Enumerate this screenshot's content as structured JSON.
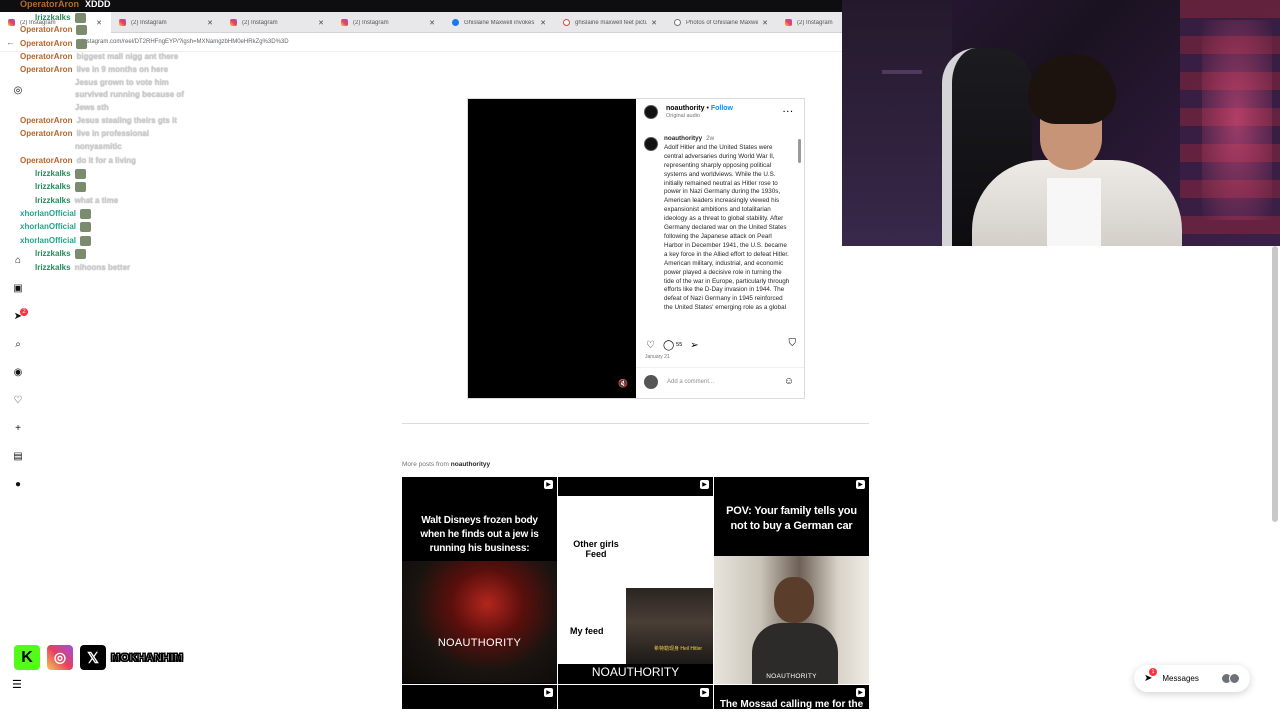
{
  "stream_chat_title": {
    "user": "OperatorAron",
    "message": "XDDD"
  },
  "tabs": [
    {
      "label": "(2) Instagram",
      "favicon": "instagram-icon"
    },
    {
      "label": "(2) Instagram",
      "favicon": "instagram-icon"
    },
    {
      "label": "(2) Instagram",
      "favicon": "instagram-icon"
    },
    {
      "label": "(2) Instagram",
      "favicon": "instagram-icon"
    },
    {
      "label": "Ghislaine Maxwell invokes 5...",
      "favicon": "facebook-icon"
    },
    {
      "label": "ghislaine maxwell feet pictur...",
      "favicon": "google-icon"
    },
    {
      "label": "Photos of Ghislaine Maxwell",
      "favicon": "globe-icon"
    },
    {
      "label": "(2) Instagram",
      "favicon": "instagram-icon"
    }
  ],
  "address_bar": {
    "url": "instagram.com/reel/DT2RHFngEYP/?igsh=MXNamgzbHM0eHRkZg%3D%3D"
  },
  "chat": [
    {
      "user": "Irizzkalks",
      "color": "#2a8a5c",
      "text": "",
      "emote": true
    },
    {
      "user": "OperatorAron",
      "color": "#b5652a",
      "text": "",
      "emote": true
    },
    {
      "user": "OperatorAron",
      "color": "#b5652a",
      "text": "",
      "emote": true
    },
    {
      "user": "OperatorAron",
      "color": "#b5652a",
      "text": "biggest mall nigg ant there"
    },
    {
      "user": "OperatorAron",
      "color": "#b5652a",
      "text": "live in 9 months on here"
    },
    {
      "user": "",
      "color": "#b5652a",
      "text": "Jesus grown to vote him"
    },
    {
      "user": "",
      "color": "#b5652a",
      "text": "survived running because of"
    },
    {
      "user": "",
      "color": "#b5652a",
      "text": "Jews sth"
    },
    {
      "user": "OperatorAron",
      "color": "#b5652a",
      "text": "Jesus stealing theirs gts it"
    },
    {
      "user": "OperatorAron",
      "color": "#b5652a",
      "text": "live in professional"
    },
    {
      "user": "",
      "color": "#b5652a",
      "text": "nonyasmitic"
    },
    {
      "user": "OperatorAron",
      "color": "#b5652a",
      "text": "do it for a living"
    },
    {
      "user": "Irizzkalks",
      "color": "#2a8a5c",
      "text": "",
      "emote": true
    },
    {
      "user": "Irizzkalks",
      "color": "#2a8a5c",
      "text": "",
      "emote": true
    },
    {
      "user": "Irizzkalks",
      "color": "#2a8a5c",
      "text": "what a time"
    },
    {
      "user": "xhorlanOfficial",
      "color": "#21a58a",
      "text": "",
      "emote": true
    },
    {
      "user": "xhorlanOfficial",
      "color": "#21a58a",
      "text": "",
      "emote": true
    },
    {
      "user": "xhorlanOfficial",
      "color": "#21a58a",
      "text": "",
      "emote": true
    },
    {
      "user": "Irizzkalks",
      "color": "#2a8a5c",
      "text": "",
      "emote": true
    },
    {
      "user": "Irizzkalks",
      "color": "#2a8a5c",
      "text": "nihoons better"
    }
  ],
  "post": {
    "username": "noauthority",
    "follow": "Follow",
    "audio": "Original audio",
    "caption_user": "noauthorityy",
    "caption_ago": "2w",
    "caption": "Adolf Hitler and the United States were central adversaries during World War II, representing sharply opposing political systems and worldviews. While the U.S. initially remained neutral as Hitler rose to power in Nazi Germany during the 1930s, American leaders increasingly viewed his expansionist ambitions and totalitarian ideology as a threat to global stability. After Germany declared war on the United States following the Japanese attack on Pearl Harbor in December 1941, the U.S. became a key force in the Allied effort to defeat Hitler. American military, industrial, and economic power played a decisive role in turning the tide of the war in Europe, particularly through efforts like the D-Day invasion in 1944. The defeat of Nazi Germany in 1945 reinforced the United States' emerging role as a global",
    "comment_count": "55",
    "date": "January 21",
    "comment_placeholder": "Add a comment..."
  },
  "more_posts": {
    "prefix": "More posts from",
    "user": "noauthorityy"
  },
  "grid": [
    {
      "caption": "Walt Disneys frozen body when he finds out a jew is running his business:",
      "brand": "NOAUTHORITY"
    },
    {
      "line1": "Other girls Feed",
      "line2": "My feed",
      "sub": "希特勒现身 Heil Hitler",
      "brand": "NOAUTHORITY"
    },
    {
      "caption": "POV: Your family tells you not to buy a German car",
      "brand": "NOAUTHORITY"
    }
  ],
  "grid_row2": [
    {
      "caption": ""
    },
    {
      "caption": ""
    },
    {
      "caption": "The Mossad calling me for the"
    }
  ],
  "messages": {
    "label": "Messages",
    "badge": "1"
  },
  "notification_badge": "2",
  "social": {
    "handle": "MOKHANHIM"
  }
}
